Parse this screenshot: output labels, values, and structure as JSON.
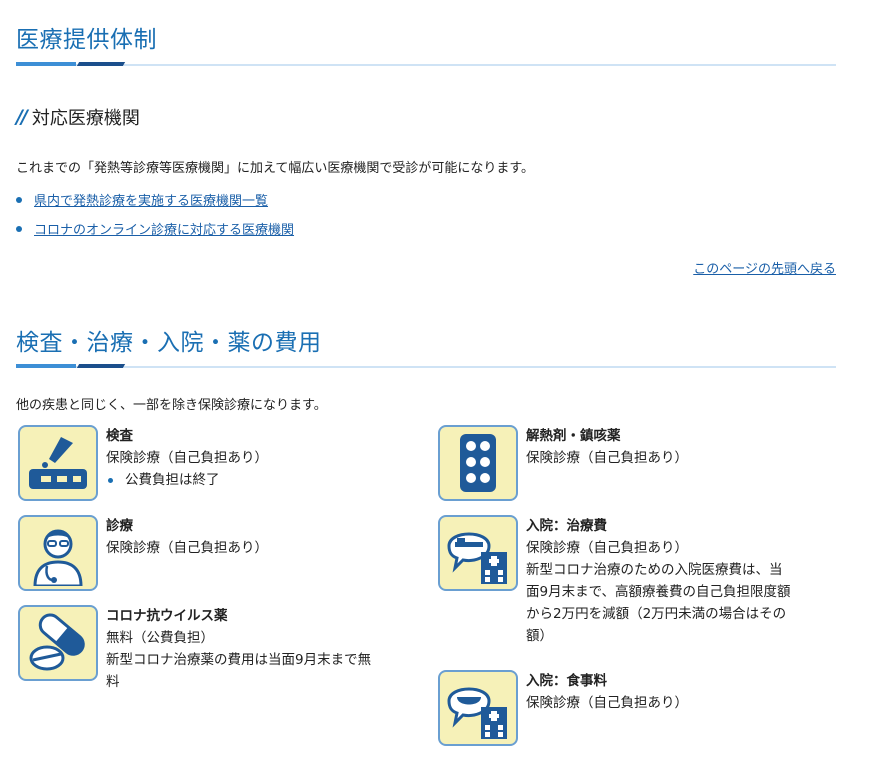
{
  "section1": {
    "title": "医療提供体制",
    "subheading": "対応医療機関",
    "intro": "これまでの「発熱等診療等医療機関」に加えて幅広い医療機関で受診が可能になります。",
    "links": [
      "県内で発熱診療を実施する医療機関一覧",
      "コロナのオンライン診療に対応する医療機関"
    ],
    "back_to_top": "このページの先頭へ戻る"
  },
  "section2": {
    "title": "検査・治療・入院・薬の費用",
    "intro": "他の疾患と同じく、一部を除き保険診療になります。",
    "items": [
      {
        "icon": "test-kit-icon",
        "title": "検査",
        "lines": [
          "保険診療（自己負担あり）"
        ],
        "bullet": "公費負担は終了"
      },
      {
        "icon": "doctor-icon",
        "title": "診療",
        "lines": [
          "保険診療（自己負担あり）"
        ]
      },
      {
        "icon": "capsule-pill-icon",
        "title": "コロナ抗ウイルス薬",
        "lines": [
          "無料（公費負担）",
          "新型コロナ治療薬の費用は当面9月末まで無",
          "料"
        ]
      },
      {
        "icon": "medicine-tablets-icon",
        "title": "解熱剤・鎮咳薬",
        "lines": [
          "保険診療（自己負担あり）"
        ]
      },
      {
        "icon": "hospital-bed-icon",
        "title": "入院：治療費",
        "lines": [
          "保険診療（自己負担あり）",
          "新型コロナ治療のための入院医療費は、当",
          "面9月末まで、高額療養費の自己負担限度額",
          "から2万円を減額（2万円未満の場合はその",
          "額）"
        ]
      },
      {
        "icon": "hospital-meal-icon",
        "title": "入院：食事料",
        "lines": [
          "保険診療（自己負担あり）"
        ]
      }
    ]
  },
  "colors": {
    "heading": "#1a6fb3",
    "icon_bg": "#f6f1b8",
    "icon_border": "#6a9fd1",
    "icon_dark": "#1f5a99"
  }
}
